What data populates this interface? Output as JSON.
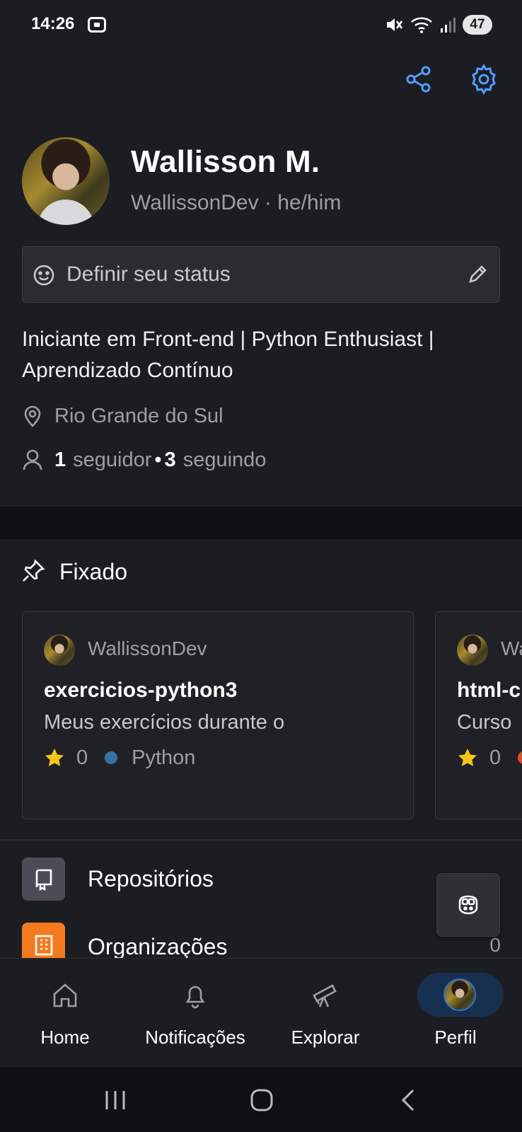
{
  "status_bar": {
    "time": "14:26",
    "battery": "47"
  },
  "profile": {
    "name": "Wallisson M.",
    "handle_line": "WallissonDev · he/him",
    "status_placeholder": "Definir seu status",
    "bio": "Iniciante em Front-end | Python Enthusiast | Aprendizado Contínuo",
    "location": "Rio Grande do Sul",
    "followers_count": "1",
    "followers_label": "seguidor",
    "following_count": "3",
    "following_label": "seguindo"
  },
  "pinned": {
    "title": "Fixado",
    "cards": [
      {
        "owner": "WallissonDev",
        "name": "exercicios-python3",
        "description": "Meus exercícios durante o",
        "stars": "0",
        "language": "Python",
        "language_color": "#3572A5"
      },
      {
        "owner": "Wa",
        "name": "html-c",
        "description": "Curso",
        "stars": "0",
        "language": "",
        "language_color": "#e34c26"
      }
    ]
  },
  "list": [
    {
      "label": "Repositórios",
      "count": "",
      "icon": "repo-icon",
      "icon_bg": "#4a4d55"
    },
    {
      "label": "Organizações",
      "count": "0",
      "icon": "organization-icon",
      "icon_bg": "#f47a20"
    }
  ],
  "bottom_nav": [
    {
      "label": "Home",
      "icon": "home-icon"
    },
    {
      "label": "Notificações",
      "icon": "bell-icon"
    },
    {
      "label": "Explorar",
      "icon": "telescope-icon"
    },
    {
      "label": "Perfil",
      "icon": "avatar",
      "active": true
    }
  ],
  "colors": {
    "accent": "#4f9eff",
    "background": "#1c1d22",
    "star": "#f5c518"
  }
}
